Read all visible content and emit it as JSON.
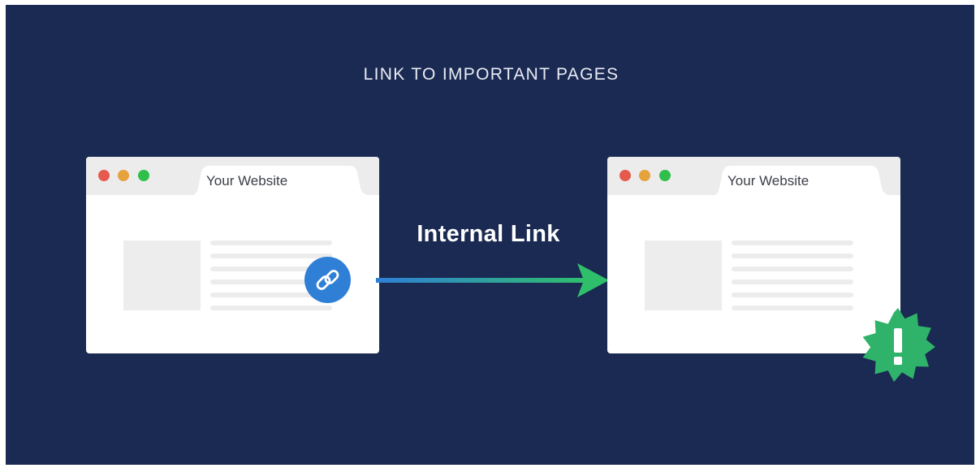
{
  "title": "LINK TO IMPORTANT PAGES",
  "source_browser": {
    "tab_label": "Your Website"
  },
  "target_browser": {
    "tab_label": "Your Website"
  },
  "connector": {
    "label": "Internal Link",
    "gradient_start": "#2f7fd6",
    "gradient_end": "#2fbf6a"
  },
  "icons": {
    "link": "link-icon",
    "alert": "exclamation-icon"
  },
  "colors": {
    "background": "#1b2a52",
    "link_badge": "#2f7fd6",
    "alert_badge": "#2fb36a",
    "window_red": "#e55a4d",
    "window_yellow": "#e6a23c",
    "window_green": "#2fbf4a"
  }
}
